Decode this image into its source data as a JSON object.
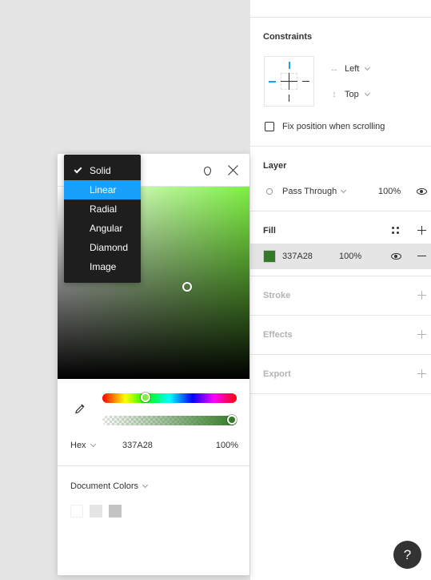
{
  "constraints": {
    "title": "Constraints",
    "horizontal": {
      "icon": "↔",
      "value": "Left"
    },
    "vertical": {
      "icon": "↕",
      "value": "Top"
    },
    "fix_position_label": "Fix position when scrolling"
  },
  "layer": {
    "title": "Layer",
    "blend_mode": "Pass Through",
    "opacity": "100%"
  },
  "fill": {
    "title": "Fill",
    "hex": "337A28",
    "opacity": "100%",
    "color": "#337A28"
  },
  "stroke": {
    "title": "Stroke"
  },
  "effects": {
    "title": "Effects"
  },
  "export": {
    "title": "Export"
  },
  "help": {
    "label": "?"
  },
  "picker": {
    "fill_types": [
      "Solid",
      "Linear",
      "Radial",
      "Angular",
      "Diamond",
      "Image"
    ],
    "checked_type": "Solid",
    "hovered_type": "Linear",
    "hue_color": "#7EF043",
    "color_model": "Hex",
    "hex_value": "337A28",
    "alpha": "100%",
    "document_colors_title": "Document Colors",
    "document_colors": [
      "#FFFFFF",
      "#E5E5E5",
      "#C4C4C4"
    ]
  }
}
